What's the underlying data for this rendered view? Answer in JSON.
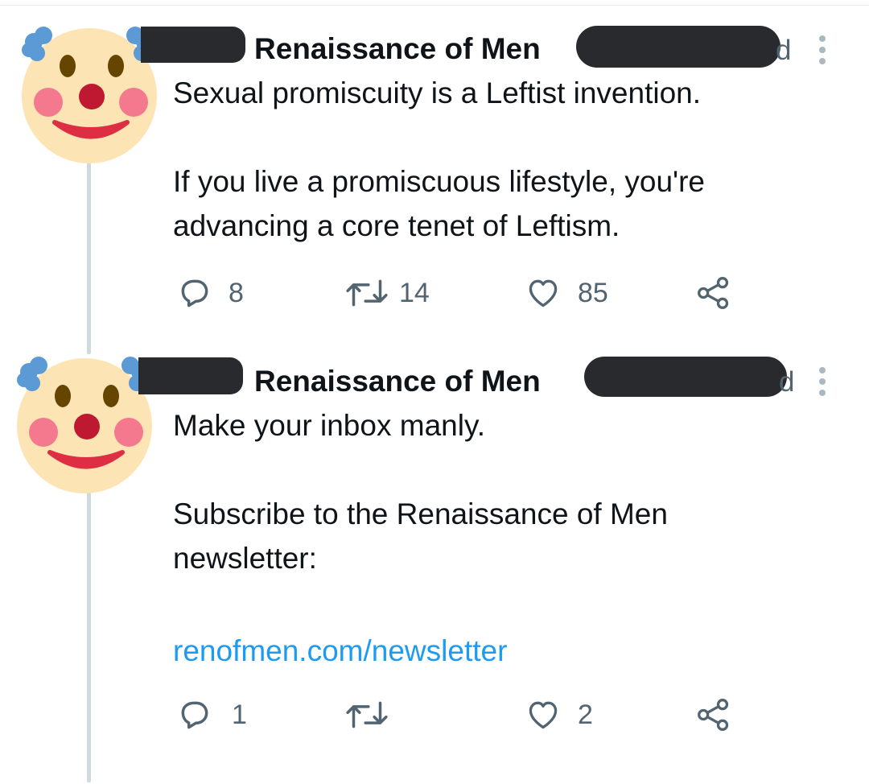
{
  "tweets": [
    {
      "display_name": "Renaissance of Men",
      "time_fragment": "d",
      "text": "Sexual promiscuity is a Leftist invention.\n\nIf you live a promiscuous lifestyle, you're advancing a core tenet of Leftism.",
      "actions": {
        "replies": "8",
        "retweets": "14",
        "likes": "85"
      }
    },
    {
      "display_name": "Renaissance of Men",
      "time_fragment": "d",
      "text": "Make your inbox manly.\n\nSubscribe to the Renaissance of Men newsletter:",
      "link": "renofmen.com/newsletter",
      "actions": {
        "replies": "1",
        "retweets": "",
        "likes": "2"
      }
    }
  ],
  "icons": {
    "avatar": "clown-face-icon",
    "reply": "reply-icon",
    "retweet": "retweet-icon",
    "like": "heart-icon",
    "share": "share-icon",
    "more": "more-options-icon"
  },
  "colors": {
    "text": "#0f1419",
    "secondary": "#536471",
    "link": "#1d9bf0",
    "thread_line": "#cfd9de",
    "redaction": "#282a2e"
  }
}
